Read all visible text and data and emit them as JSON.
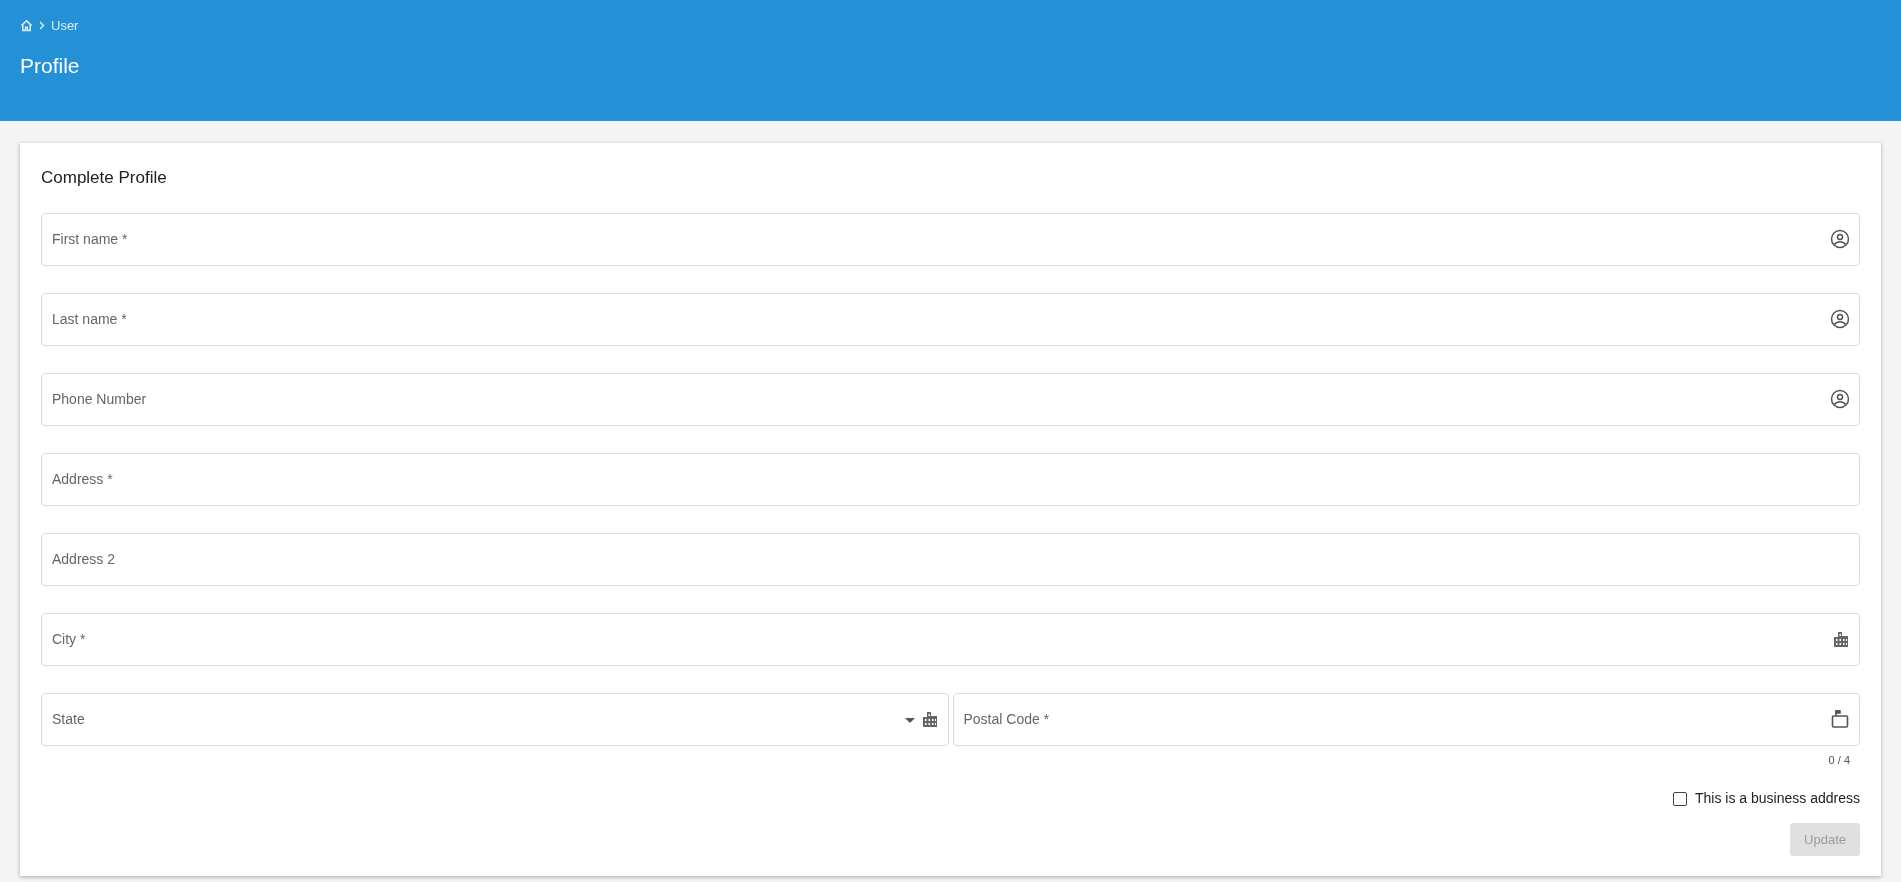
{
  "breadcrumb": {
    "items": [
      "User"
    ]
  },
  "page_title": "Profile",
  "card": {
    "title": "Complete Profile",
    "fields": [
      {
        "placeholder": "First name *",
        "kind": "person"
      },
      {
        "placeholder": "Last name *",
        "kind": "person"
      },
      {
        "placeholder": "Phone Number",
        "kind": "person"
      },
      {
        "placeholder": "Address *",
        "kind": "plain"
      },
      {
        "placeholder": "Address 2",
        "kind": "plain"
      },
      {
        "placeholder": "City *",
        "kind": "city"
      }
    ],
    "state_select": {
      "placeholder": "State",
      "kind": "city"
    },
    "postal_code": {
      "placeholder": "Postal Code *",
      "kind": "postal",
      "counter": "0 / 4"
    },
    "business_checkbox": {
      "label": "This is a business address",
      "checked": false
    },
    "update_button": {
      "label": "Update",
      "disabled": true
    }
  }
}
